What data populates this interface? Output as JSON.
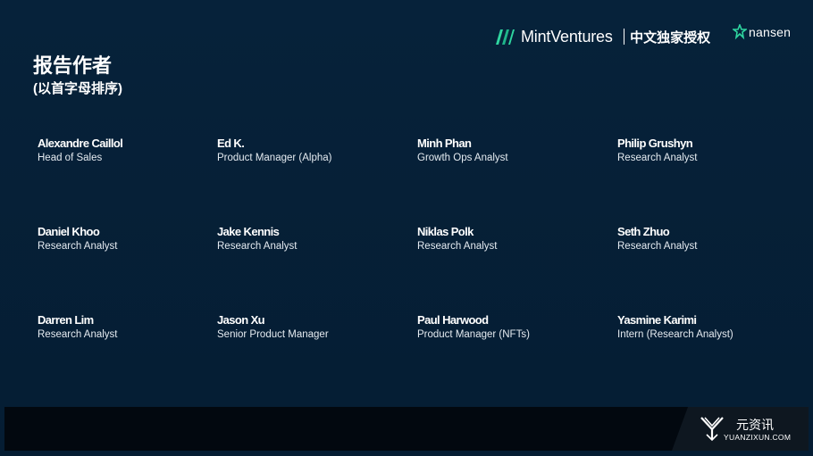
{
  "header": {
    "mint_name": "MintVentures",
    "license": "中文独家授权",
    "nansen_name": "nansen"
  },
  "title": "报告作者",
  "subtitle": "(以首字母排序)",
  "authors": [
    {
      "name": "Alexandre Caillol",
      "role": "Head of Sales"
    },
    {
      "name": "Ed K.",
      "role": "Product Manager (Alpha)"
    },
    {
      "name": "Minh Phan",
      "role": "Growth Ops Analyst"
    },
    {
      "name": "Philip Grushyn",
      "role": "Research Analyst"
    },
    {
      "name": "Daniel Khoo",
      "role": "Research Analyst"
    },
    {
      "name": "Jake Kennis",
      "role": "Research Analyst"
    },
    {
      "name": "Niklas Polk",
      "role": "Research Analyst"
    },
    {
      "name": "Seth Zhuo",
      "role": "Research Analyst"
    },
    {
      "name": "Darren Lim",
      "role": "Research Analyst"
    },
    {
      "name": "Jason Xu",
      "role": "Senior Product Manager"
    },
    {
      "name": "Paul Harwood",
      "role": "Product Manager (NFTs)"
    },
    {
      "name": "Yasmine Karimi",
      "role": "Intern (Research Analyst)"
    }
  ],
  "footer": {
    "cn": "元资讯",
    "en": "YUANZIXUN.COM"
  },
  "colors": {
    "background": "#062038",
    "mint_accent": "#2fd6a0",
    "footer": "#02080f"
  }
}
